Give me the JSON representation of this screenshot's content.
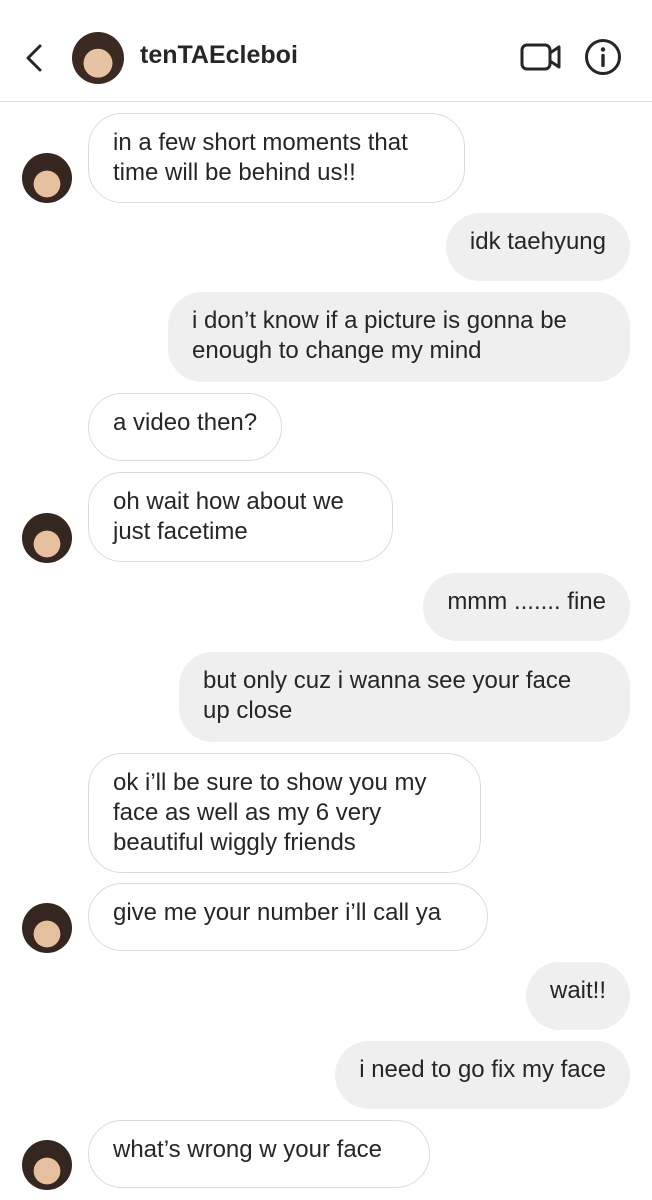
{
  "header": {
    "username": "tenTAEcleboi",
    "back_icon": "chevron-left-icon",
    "video_icon": "video-camera-icon",
    "info_icon": "info-icon"
  },
  "messages": [
    {
      "side": "in",
      "lines": [
        "in a few short moments that",
        "time will be behind us!!"
      ]
    },
    {
      "side": "out",
      "lines": [
        "idk taehyung"
      ]
    },
    {
      "side": "out",
      "lines": [
        "i don’t know if a picture is gonna be",
        "enough to change my mind"
      ]
    },
    {
      "side": "in",
      "lines": [
        "a video then?"
      ]
    },
    {
      "side": "in",
      "lines": [
        "oh wait how about we",
        "just facetime"
      ]
    },
    {
      "side": "out",
      "lines": [
        "mmm ....... fine"
      ]
    },
    {
      "side": "out",
      "lines": [
        "but only cuz i wanna see your face",
        "up close"
      ]
    },
    {
      "side": "in",
      "lines": [
        "ok i’ll be sure to show you my",
        "face as well as my 6 very",
        "beautiful wiggly friends"
      ]
    },
    {
      "side": "in",
      "lines": [
        "give me your number i’ll call ya"
      ]
    },
    {
      "side": "out",
      "lines": [
        "wait!!"
      ]
    },
    {
      "side": "out",
      "lines": [
        "i need to go fix my face"
      ]
    },
    {
      "side": "in",
      "lines": [
        "what’s wrong w your face"
      ]
    }
  ]
}
